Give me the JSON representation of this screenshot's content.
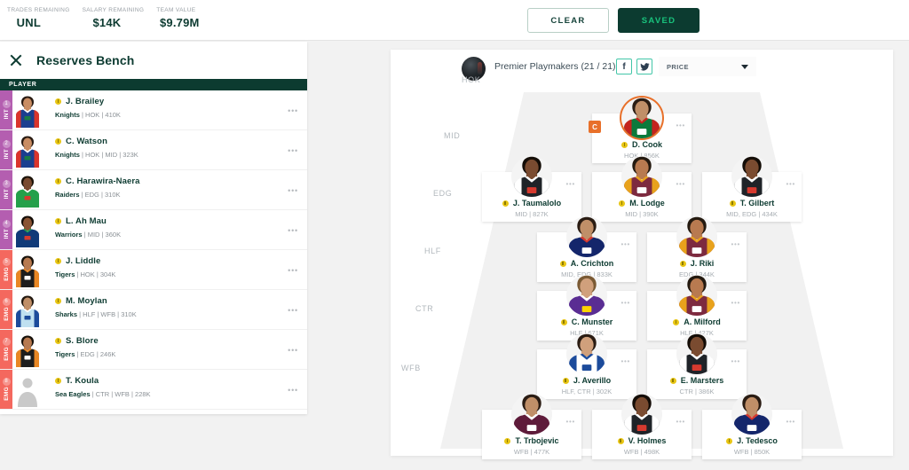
{
  "topbar": {
    "stats": [
      {
        "label": "TRADES REMAINING",
        "value": "UNL"
      },
      {
        "label": "SALARY REMAINING",
        "value": "$14K"
      },
      {
        "label": "TEAM VALUE",
        "value": "$9.79M"
      }
    ],
    "clear_label": "CLEAR",
    "saved_label": "SAVED",
    "accent_green": "#0c3b30",
    "accent_bright_green": "#19c37d"
  },
  "sidebar": {
    "title": "Reserves Bench",
    "close_icon": "close-icon",
    "column_header": "PLAYER",
    "menu_icon": "•••",
    "int_color": "#b45eb0",
    "emg_color": "#f4685e",
    "players": [
      {
        "num": "1",
        "type": "INT",
        "name": "J. Brailey",
        "team": "Knights",
        "detail": "HOK | 410K",
        "jersey": "knights"
      },
      {
        "num": "2",
        "type": "INT",
        "name": "C. Watson",
        "team": "Knights",
        "detail": "HOK | MID | 323K",
        "jersey": "knights"
      },
      {
        "num": "3",
        "type": "INT",
        "name": "C. Harawira-Naera",
        "team": "Raiders",
        "detail": "EDG | 310K",
        "jersey": "raiders"
      },
      {
        "num": "4",
        "type": "INT",
        "name": "L. Ah Mau",
        "team": "Warriors",
        "detail": "MID | 360K",
        "jersey": "warriors"
      },
      {
        "num": "5",
        "type": "EMG",
        "name": "J. Liddle",
        "team": "Tigers",
        "detail": "HOK | 304K",
        "jersey": "tigers"
      },
      {
        "num": "6",
        "type": "EMG",
        "name": "M. Moylan",
        "team": "Sharks",
        "detail": "HLF | WFB | 310K",
        "jersey": "sharks"
      },
      {
        "num": "7",
        "type": "EMG",
        "name": "S. Blore",
        "team": "Tigers",
        "detail": "EDG | 246K",
        "jersey": "tigers"
      },
      {
        "num": "8",
        "type": "EMG",
        "name": "T. Koula",
        "team": "Sea Eagles",
        "detail": "CTR | WFB | 228K",
        "jersey": "blank"
      }
    ]
  },
  "field": {
    "team_name": "Premier Playmakers (21 / 21)",
    "avatar_icon": "team-avatar",
    "facebook_icon": "f",
    "twitter_icon": "🐦",
    "sort_value": "PRICE",
    "position_labels": [
      "HOK",
      "MID",
      "EDG",
      "HLF",
      "CTR",
      "WFB"
    ],
    "menu_icon": "•••",
    "captain_badge": "C",
    "captain_color": "#e8702a",
    "rows": [
      {
        "position": "HOK",
        "players": [
          {
            "name": "D. Cook",
            "detail": "HOK | 856K",
            "jersey": "rabbitohs",
            "captain": true
          }
        ]
      },
      {
        "position": "MID",
        "players": [
          {
            "name": "J. Taumalolo",
            "detail": "MID | 827K",
            "jersey": "cowboys",
            "captain": false
          },
          {
            "name": "M. Lodge",
            "detail": "MID | 390K",
            "jersey": "broncos",
            "captain": false
          },
          {
            "name": "T. Gilbert",
            "detail": "MID, EDG | 434K",
            "jersey": "cowboys",
            "captain": false
          }
        ]
      },
      {
        "position": "EDG",
        "players": [
          {
            "name": "A. Crichton",
            "detail": "MID, EDG | 833K",
            "jersey": "roosters",
            "captain": false
          },
          {
            "name": "J. Riki",
            "detail": "EDG | 344K",
            "jersey": "broncos",
            "captain": false
          }
        ]
      },
      {
        "position": "HLF",
        "players": [
          {
            "name": "C. Munster",
            "detail": "HLF | 671K",
            "jersey": "storm",
            "captain": false
          },
          {
            "name": "A. Milford",
            "detail": "HLF | 427K",
            "jersey": "broncos",
            "captain": false
          }
        ]
      },
      {
        "position": "CTR",
        "players": [
          {
            "name": "J. Averillo",
            "detail": "HLF, CTR | 302K",
            "jersey": "bulldogs",
            "captain": false
          },
          {
            "name": "E. Marsters",
            "detail": "CTR | 386K",
            "jersey": "cowboys",
            "captain": false
          }
        ]
      },
      {
        "position": "WFB",
        "players": [
          {
            "name": "T. Trbojevic",
            "detail": "WFB | 477K",
            "jersey": "seaeagles",
            "captain": false
          },
          {
            "name": "V. Holmes",
            "detail": "WFB | 498K",
            "jersey": "cowboys",
            "captain": false
          },
          {
            "name": "J. Tedesco",
            "detail": "WFB | 850K",
            "jersey": "roosters",
            "captain": false
          }
        ]
      }
    ]
  }
}
